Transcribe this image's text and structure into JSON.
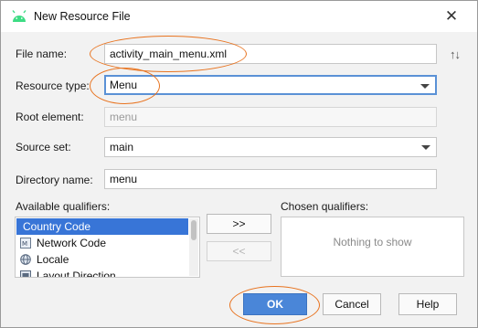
{
  "window": {
    "title": "New Resource File",
    "icon": "android-icon",
    "close_symbol": "✕"
  },
  "form": {
    "file_name": {
      "label": "File name:",
      "value": "activity_main_menu.xml"
    },
    "resource_type": {
      "label": "Resource type:",
      "value": "Menu"
    },
    "root_element": {
      "label": "Root element:",
      "value": "menu"
    },
    "source_set": {
      "label": "Source set:",
      "value": "main"
    },
    "directory_name": {
      "label": "Directory name:",
      "value": "menu"
    },
    "sort_symbol": "↑↓"
  },
  "qualifiers": {
    "available_label": "Available qualifiers:",
    "chosen_label": "Chosen qualifiers:",
    "items": [
      {
        "label": "Country Code",
        "selected": true,
        "icon": ""
      },
      {
        "label": "Network Code",
        "selected": false,
        "icon": "network-code-icon"
      },
      {
        "label": "Locale",
        "selected": false,
        "icon": "globe-icon"
      },
      {
        "label": "Layout Direction",
        "selected": false,
        "icon": "layout-direction-icon"
      }
    ],
    "add_label": ">>",
    "remove_label": "<<",
    "empty_text": "Nothing to show"
  },
  "buttons": {
    "ok": "OK",
    "cancel": "Cancel",
    "help": "Help"
  },
  "colors": {
    "accent": "#4a86d8",
    "selection": "#3875d7",
    "annotation": "#e8731f"
  }
}
